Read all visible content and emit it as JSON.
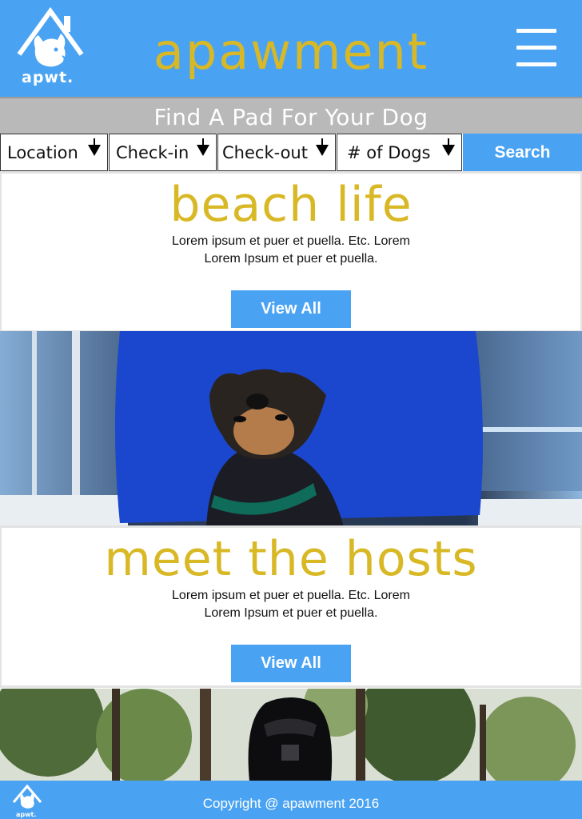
{
  "header": {
    "logo_text": "apwt.",
    "brand": "apawment",
    "menu_icon": "hamburger-menu-icon"
  },
  "tagline": "Find A Pad For Your Dog",
  "search": {
    "filters": [
      {
        "label": "Location"
      },
      {
        "label": "Check-in"
      },
      {
        "label": "Check-out"
      },
      {
        "label": "# of Dogs"
      }
    ],
    "button_label": "Search"
  },
  "sections": [
    {
      "title": "beach life",
      "line1": "Lorem ipsum et puer et puella. Etc. Lorem",
      "line2": "Lorem Ipsum et puer et puella.",
      "button_label": "View All"
    },
    {
      "title": "meet the hosts",
      "line1": "Lorem ipsum et puer et puella. Etc. Lorem",
      "line2": "Lorem Ipsum et puer et puella.",
      "button_label": "View All"
    }
  ],
  "footer": {
    "copyright": "Copyright @ apawment 2016"
  },
  "colors": {
    "brand_blue": "#4aa3f2",
    "brand_gold": "#d9b825",
    "tagline_gray": "#b9b9b9"
  }
}
